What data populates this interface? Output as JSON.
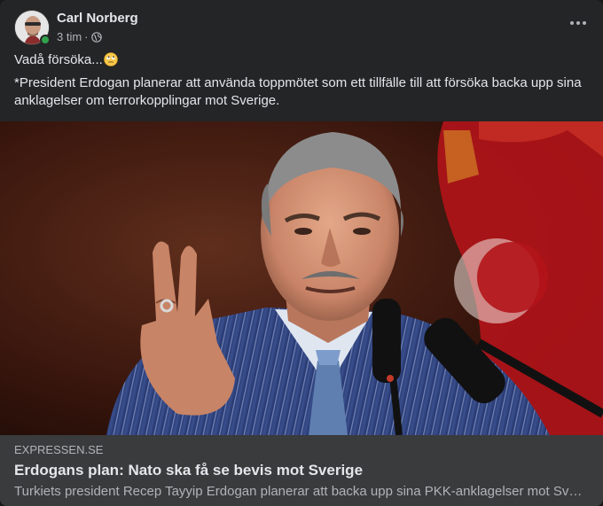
{
  "post": {
    "author": "Carl Norberg",
    "time": "3 tim",
    "separator": "·",
    "privacy_icon": "globe-icon",
    "body_line1": "Vadå försöka...",
    "body_emoji": "face-with-rolling-eyes-emoji",
    "body_paragraph": "*President Erdogan planerar att använda toppmötet som ett tillfälle till att försöka backa upp sina anklagelser om terrorkopplingar mot Sverige."
  },
  "link": {
    "domain": "EXPRESSEN.SE",
    "title": "Erdogans plan: Nato ska få se bevis mot Sverige",
    "description": "Turkiets president Recep Tayyip Erdogan planerar att backa upp sina PKK-anklagelser mot Sverige…"
  },
  "colors": {
    "card_background": "#242526",
    "link_meta_background": "#3a3b3c",
    "primary_text": "#e4e6eb",
    "secondary_text": "#b0b3b8",
    "online_status": "#31a24c"
  }
}
